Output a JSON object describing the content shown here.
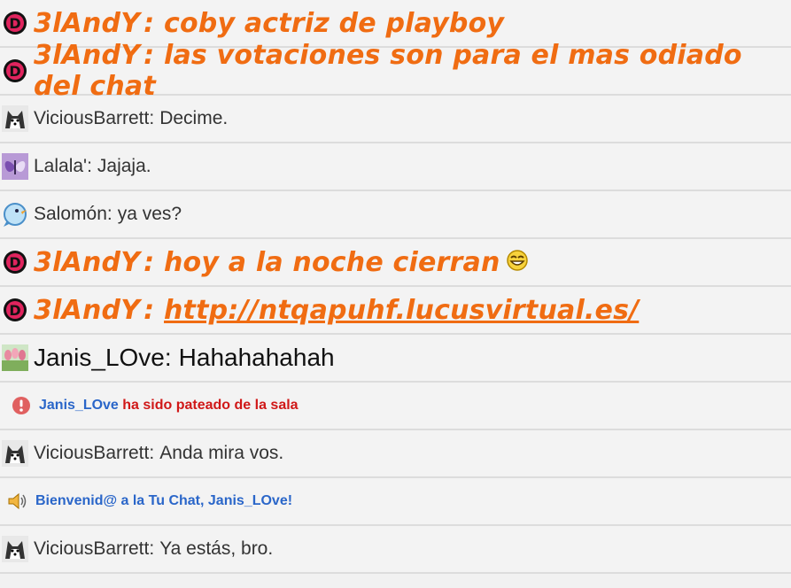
{
  "messages": [
    {
      "nick": "3lAndY",
      "text": "coby actriz de playboy"
    },
    {
      "nick": "3lAndY",
      "text": "las votaciones son para el mas odiado del chat"
    },
    {
      "nick": "ViciousBarrett",
      "text": "Decime."
    },
    {
      "nick": "Lalala'",
      "text": "Jajaja."
    },
    {
      "nick": "Salomón",
      "text": "ya ves?"
    },
    {
      "nick": "3lAndY",
      "text": "hoy a la noche cierran"
    },
    {
      "nick": "3lAndY",
      "link": "http://ntqapuhf.lucusvirtual.es/"
    },
    {
      "nick": "Janis_LOve",
      "text": "Hahahahahah"
    },
    {
      "nick": "Janis_LOve",
      "text": "ha sido pateado de la sala"
    },
    {
      "nick": "ViciousBarrett",
      "text": "Anda mira vos."
    },
    {
      "text": "Bienvenid@ a la Tu Chat, Janis_LOve!"
    },
    {
      "nick": "ViciousBarrett",
      "text": "Ya estás, bro."
    }
  ],
  "colon": ":",
  "colors": {
    "highlight": "#f06c12",
    "system_blue": "#2a66c9",
    "system_red": "#d01818"
  }
}
